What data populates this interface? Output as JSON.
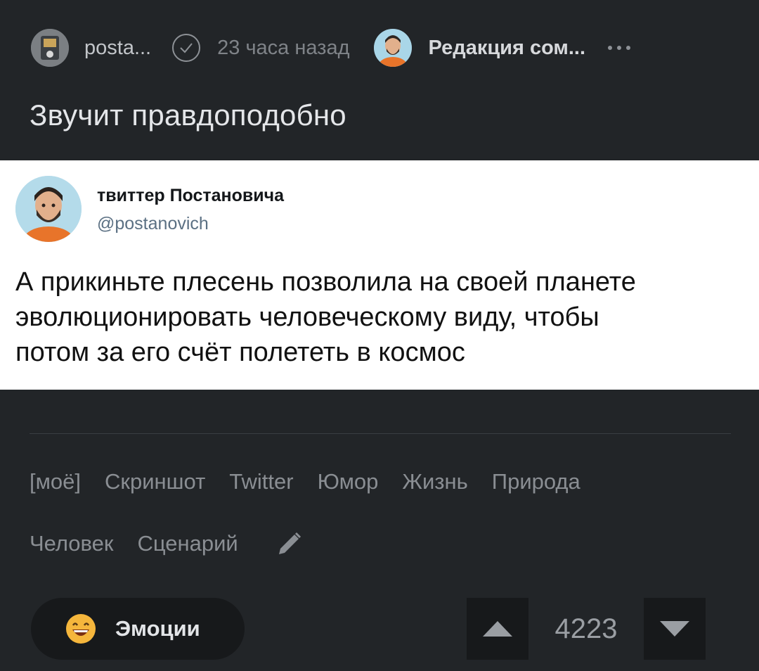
{
  "header": {
    "author_name": "posta...",
    "time_ago": "23 часа назад",
    "community_name": "Редакция сом...",
    "verified_icon": "check-circle-icon",
    "more_icon": "more-dots-icon"
  },
  "post": {
    "title": "Звучит правдоподобно"
  },
  "tweet": {
    "name": "твиттер Постановича",
    "handle": "@postanovich",
    "lines": [
      "А прикиньте плесень позволила на своей планете",
      "эволюционировать  человеческому виду, чтобы",
      "потом за его счёт полететь в космос"
    ]
  },
  "tags": {
    "row1": [
      "[моё]",
      "Скриншот",
      "Twitter",
      "Юмор",
      "Жизнь",
      "Природа"
    ],
    "row2": [
      "Человек",
      "Сценарий"
    ],
    "edit_icon": "pencil-icon"
  },
  "footer": {
    "emotions_label": "Эмоции",
    "emotions_icon": "grinning-emoji-icon",
    "rating": "4223",
    "upvote_icon": "triangle-up-icon",
    "downvote_icon": "triangle-down-icon"
  },
  "colors": {
    "background": "#222528",
    "tweet_background": "#ffffff",
    "button_background": "#17191b",
    "muted_text": "#8a8e93"
  }
}
